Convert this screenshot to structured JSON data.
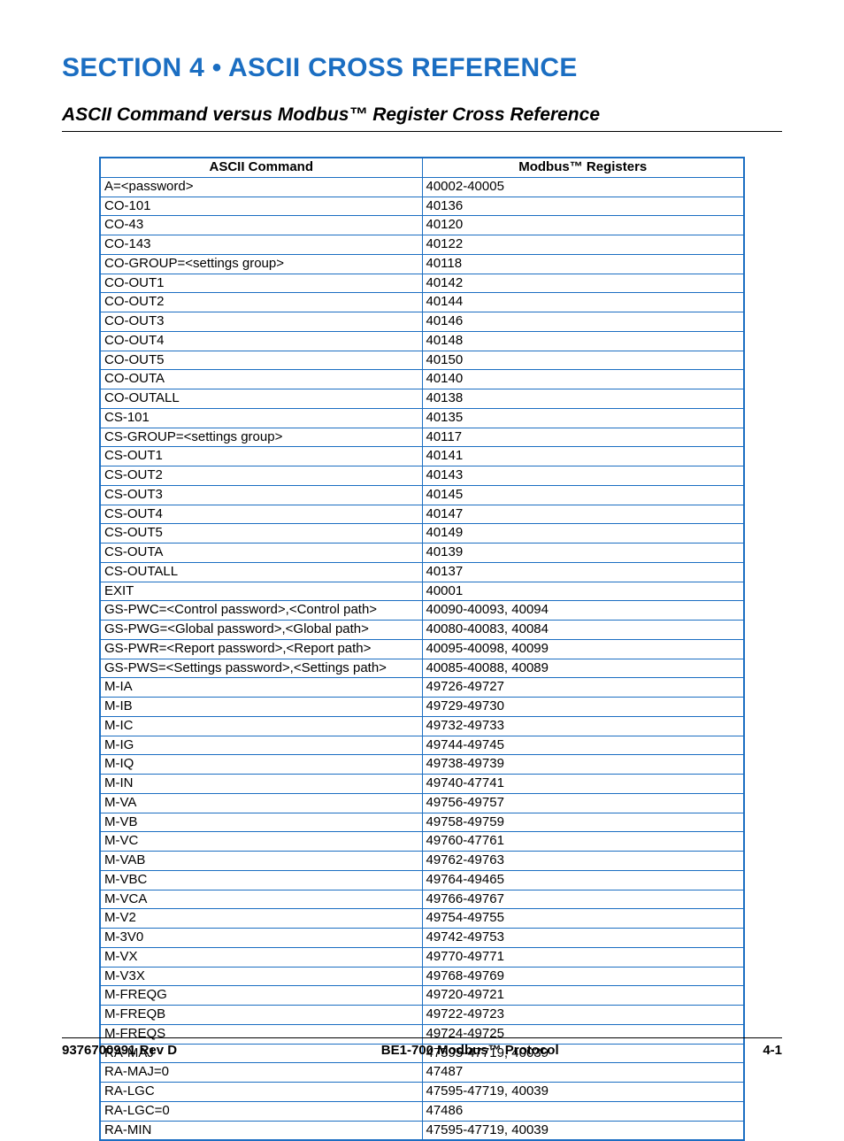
{
  "title": "SECTION 4 • ASCII CROSS REFERENCE",
  "subtitle": "ASCII Command versus Modbus™ Register Cross Reference",
  "table": {
    "headers": [
      "ASCII Command",
      "Modbus™ Registers"
    ],
    "rows": [
      [
        "A=<password>",
        "40002-40005"
      ],
      [
        "CO-101",
        "40136"
      ],
      [
        "CO-43",
        "40120"
      ],
      [
        "CO-143",
        "40122"
      ],
      [
        "CO-GROUP=<settings group>",
        "40118"
      ],
      [
        "CO-OUT1",
        "40142"
      ],
      [
        "CO-OUT2",
        "40144"
      ],
      [
        "CO-OUT3",
        "40146"
      ],
      [
        "CO-OUT4",
        "40148"
      ],
      [
        "CO-OUT5",
        "40150"
      ],
      [
        "CO-OUTA",
        "40140"
      ],
      [
        "CO-OUTALL",
        "40138"
      ],
      [
        "CS-101",
        "40135"
      ],
      [
        "CS-GROUP=<settings group>",
        "40117"
      ],
      [
        "CS-OUT1",
        "40141"
      ],
      [
        "CS-OUT2",
        "40143"
      ],
      [
        "CS-OUT3",
        "40145"
      ],
      [
        "CS-OUT4",
        "40147"
      ],
      [
        "CS-OUT5",
        "40149"
      ],
      [
        "CS-OUTA",
        "40139"
      ],
      [
        "CS-OUTALL",
        "40137"
      ],
      [
        "EXIT",
        "40001"
      ],
      [
        "GS-PWC=<Control password>,<Control path>",
        "40090-40093, 40094"
      ],
      [
        "GS-PWG=<Global password>,<Global path>",
        "40080-40083, 40084"
      ],
      [
        "GS-PWR=<Report password>,<Report path>",
        "40095-40098, 40099"
      ],
      [
        "GS-PWS=<Settings password>,<Settings path>",
        "40085-40088, 40089"
      ],
      [
        "M-IA",
        "49726-49727"
      ],
      [
        "M-IB",
        "49729-49730"
      ],
      [
        "M-IC",
        "49732-49733"
      ],
      [
        "M-IG",
        "49744-49745"
      ],
      [
        "M-IQ",
        "49738-49739"
      ],
      [
        "M-IN",
        "49740-47741"
      ],
      [
        "M-VA",
        "49756-49757"
      ],
      [
        "M-VB",
        "49758-49759"
      ],
      [
        "M-VC",
        "49760-47761"
      ],
      [
        "M-VAB",
        "49762-49763"
      ],
      [
        "M-VBC",
        "49764-49465"
      ],
      [
        "M-VCA",
        "49766-49767"
      ],
      [
        "M-V2",
        "49754-49755"
      ],
      [
        "M-3V0",
        "49742-49753"
      ],
      [
        "M-VX",
        "49770-49771"
      ],
      [
        "M-V3X",
        "49768-49769"
      ],
      [
        "M-FREQG",
        "49720-49721"
      ],
      [
        "M-FREQB",
        "49722-49723"
      ],
      [
        "M-FREQS",
        "49724-49725"
      ],
      [
        "RA-MAJ",
        "47595-47719, 40039"
      ],
      [
        "RA-MAJ=0",
        "47487"
      ],
      [
        "RA-LGC",
        "47595-47719, 40039"
      ],
      [
        "RA-LGC=0",
        "47486"
      ],
      [
        "RA-MIN",
        "47595-47719, 40039"
      ]
    ]
  },
  "footer": {
    "left": "9376700991 Rev D",
    "center": "BE1-700 Modbus™ Protocol",
    "right": "4-1"
  }
}
